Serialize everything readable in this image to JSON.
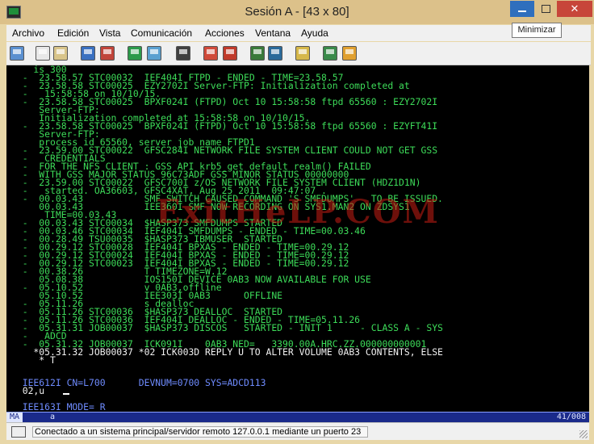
{
  "window": {
    "title": "Sesión A - [43 x 80]",
    "tooltip": "Minimizar"
  },
  "menu": [
    "Archivo",
    "Edición",
    "Vista",
    "Comunicación",
    "Acciones",
    "Ventana",
    "Ayuda"
  ],
  "toolbar_icons": [
    "print-screen-icon",
    "copy-icon",
    "paste-icon",
    "send-file-icon",
    "receive-file-icon",
    "display-icon",
    "display-2-icon",
    "keyboard-icon",
    "record-macro-icon",
    "play-macro-icon",
    "stop-macro-icon",
    "play-macro-2-icon",
    "clipboard-icon",
    "color-palette-icon",
    "tools-icon"
  ],
  "colors": {
    "terminal_bg": "#000000",
    "text_green": "#3ddc59",
    "text_white": "#f2f2f2",
    "text_blue": "#6f8cff",
    "watermark": "#c81e14",
    "oia_bg": "#1a2a8a"
  },
  "terminal_lines": [
    {
      "text": "    is 300",
      "color": "green"
    },
    {
      "text": "  -  23.58.57 STC00032  IEF404I FTPD - ENDED - TIME=23.58.57",
      "color": "green"
    },
    {
      "text": "  -  23.58.58 STC00025  EZY2702I Server-FTP: Initialization completed at",
      "color": "green"
    },
    {
      "text": "  -   15:58:58 on 10/10/15.",
      "color": "green"
    },
    {
      "text": "  -  23.58.58 STC00025  BPXF024I (FTPD) Oct 10 15:58:58 ftpd 65560 : EZY2702I",
      "color": "green"
    },
    {
      "text": "     Server-FTP:",
      "color": "green"
    },
    {
      "text": "     Initialization completed at 15:58:58 on 10/10/15.",
      "color": "green"
    },
    {
      "text": "  -  23.58.58 STC00025  BPXF024I (FTPD) Oct 10 15:58:58 ftpd 65560 : EZYFT41I",
      "color": "green"
    },
    {
      "text": "     Server-FTP:",
      "color": "green"
    },
    {
      "text": "     process id 65560, server job name FTPD1",
      "color": "green"
    },
    {
      "text": "  -  23.59.00 STC00022  GFSC284I NETWORK FILE SYSTEM CLIENT COULD NOT GET GSS",
      "color": "green"
    },
    {
      "text": "  -   CREDENTIALS",
      "color": "green"
    },
    {
      "text": "  -  FOR THE NFS CLIENT : GSS API krb5_get_default_realm() FAILED",
      "color": "green"
    },
    {
      "text": "  -  WITH GSS MAJOR STATUS 96C73ADF GSS MINOR STATUS 00000000",
      "color": "green"
    },
    {
      "text": "  -  23.59.00 STC00022  GFSC700I z/OS NETWORK FILE SYSTEM CLIENT (HDZ1D1N)",
      "color": "green"
    },
    {
      "text": "  -   started. OA36603, GFSC4XAT, Aug 25 2011  09:47:07 .",
      "color": "green"
    },
    {
      "text": "  -  00.03.43           SMF SWITCH CAUSED COMMAND 'S SMFDUMPS'   TO BE ISSUED.",
      "color": "green"
    },
    {
      "text": "     00.03.43           IEE360I SMF NOW RECORDING ON SYS1.MAN2 ON ZDSYS1",
      "color": "green"
    },
    {
      "text": "      TIME=00.03.43",
      "color": "green"
    },
    {
      "text": "  -  00.03.43 STC00034  $HASP373 SMFDUMPS STARTED",
      "color": "green"
    },
    {
      "text": "  -  00.03.46 STC00034  IEF404I SMFDUMPS - ENDED - TIME=00.03.46",
      "color": "green"
    },
    {
      "text": "  -  00.28.49 TSU00035  $HASP373 IBMUSER  STARTED",
      "color": "green"
    },
    {
      "text": "  -  00.29.12 STC00028  IEF404I BPXAS - ENDED - TIME=00.29.12",
      "color": "green"
    },
    {
      "text": "  -  00.29.12 STC00024  IEF404I BPXAS - ENDED - TIME=00.29.12",
      "color": "green"
    },
    {
      "text": "  -  00.29.12 STC00023  IEF404I BPXAS - ENDED - TIME=00.29.12",
      "color": "green"
    },
    {
      "text": "  -  00.38.26           T TIMEZONE=W.12",
      "color": "green"
    },
    {
      "text": "     05.08.38           IOS150I DEVICE 0AB3 NOW AVAILABLE FOR USE",
      "color": "green"
    },
    {
      "text": "  -  05.10.52           v 0AB3,offline",
      "color": "green"
    },
    {
      "text": "     05.10.52           IEE303I 0AB3      OFFLINE",
      "color": "green"
    },
    {
      "text": "  -  05.11.26           s dealloc",
      "color": "green"
    },
    {
      "text": "  -  05.11.26 STC00036  $HASP373 DEALLOC  STARTED",
      "color": "green"
    },
    {
      "text": "  -  05.11.26 STC00036  IEF404I DEALLOC - ENDED - TIME=05.11.26",
      "color": "green"
    },
    {
      "text": "  -  05.31.31 JOB00037  $HASP373 DISCOS   STARTED - INIT 1     - CLASS A - SYS",
      "color": "green"
    },
    {
      "text": "  -   ADCD",
      "color": "green"
    },
    {
      "text": "  -  05.31.32 JOB00037  ICK091I    0AB3 NED=   3390.00A.HRC.ZZ.000000000001",
      "color": "green"
    },
    {
      "text": "    *05.31.32 JOB00037 *02 ICK003D REPLY U TO ALTER VOLUME 0AB3 CONTENTS, ELSE",
      "color": "white"
    },
    {
      "text": "     * T",
      "color": "white"
    },
    {
      "text": "",
      "color": "green"
    },
    {
      "text": "",
      "color": "green"
    },
    {
      "text": "  IEE612I CN=L700      DEVNUM=0700 SYS=ADCD113",
      "color": "blue"
    },
    {
      "text": "  02,u",
      "color": "white"
    },
    {
      "text": "",
      "color": "green"
    },
    {
      "text": "  IEE163I MODE= R",
      "color": "blue"
    }
  ],
  "watermark_text": "ExitHeLP.COM",
  "oia": {
    "indicator": "MA",
    "mode": "a",
    "position": "41/008"
  },
  "status": {
    "text": "Conectado a un sistema principal/servidor remoto 127.0.0.1 mediante un puerto 23"
  }
}
